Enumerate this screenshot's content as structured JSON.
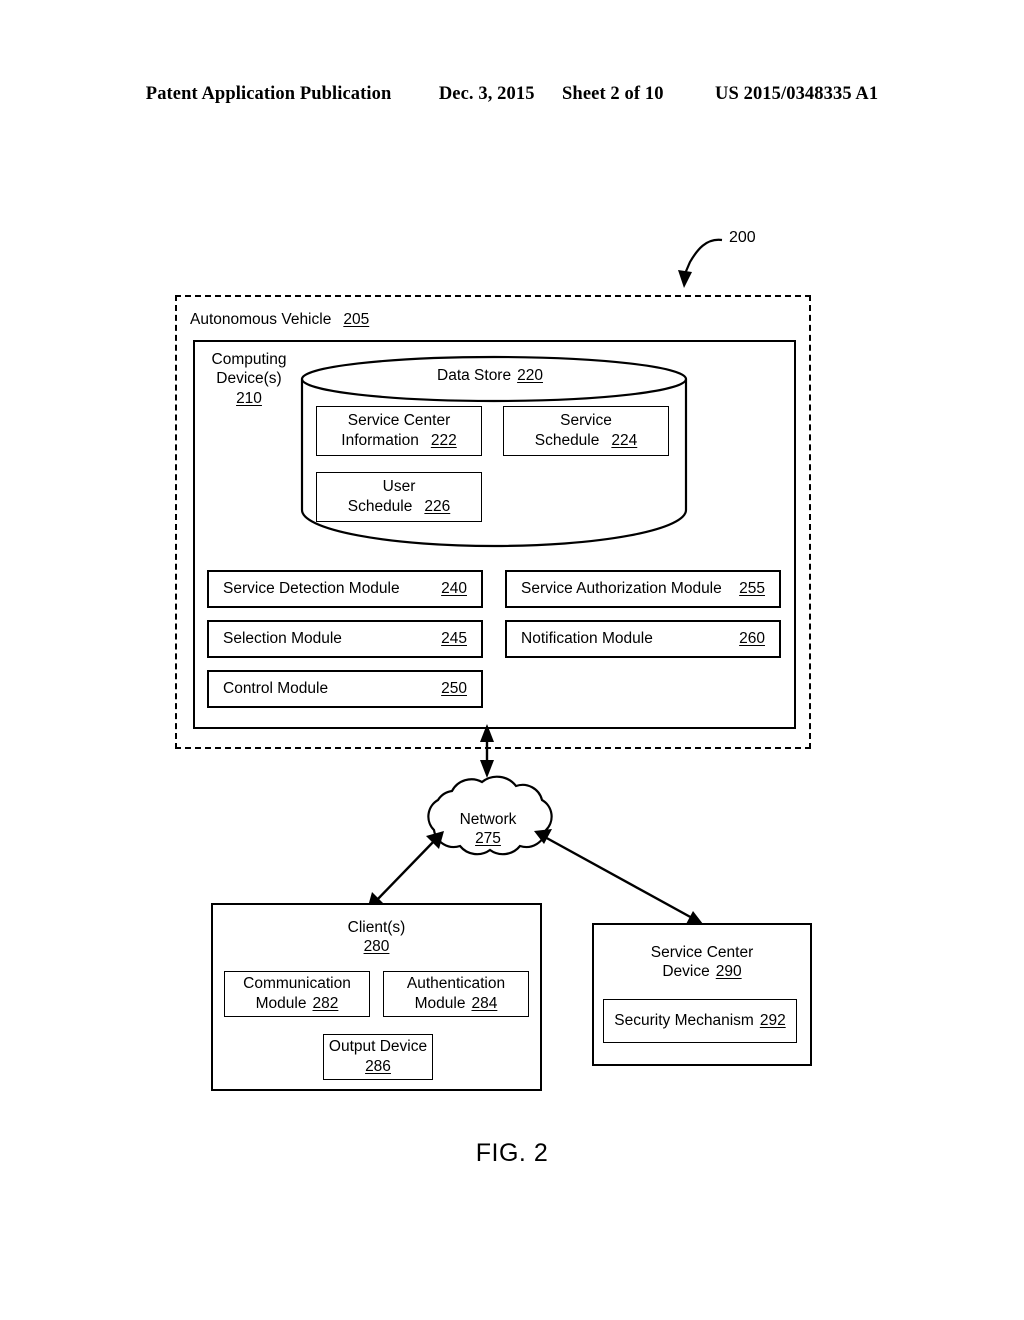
{
  "header": {
    "publication": "Patent Application Publication",
    "date": "Dec. 3, 2015",
    "sheet": "Sheet 2 of 10",
    "patent_number": "US 2015/0348335 A1"
  },
  "figure": {
    "caption": "FIG. 2",
    "system_ref": "200"
  },
  "vehicle": {
    "label": "Autonomous Vehicle",
    "ref": "205"
  },
  "computing_device": {
    "line1": "Computing",
    "line2": "Device(s)",
    "ref": "210"
  },
  "data_store": {
    "label": "Data Store",
    "ref": "220",
    "items": [
      {
        "line1": "Service Center",
        "line2": "Information",
        "ref": "222"
      },
      {
        "line1": "Service",
        "line2": "Schedule",
        "ref": "224"
      },
      {
        "line1": "User",
        "line2": "Schedule",
        "ref": "226"
      }
    ]
  },
  "modules": {
    "left": [
      {
        "label": "Service Detection Module",
        "ref": "240"
      },
      {
        "label": "Selection Module",
        "ref": "245"
      },
      {
        "label": "Control Module",
        "ref": "250"
      }
    ],
    "right": [
      {
        "label": "Service Authorization Module",
        "ref": "255"
      },
      {
        "label": "Notification Module",
        "ref": "260"
      }
    ]
  },
  "network": {
    "label": "Network",
    "ref": "275"
  },
  "client": {
    "label": "Client(s)",
    "ref": "280",
    "items": [
      {
        "line1": "Communication",
        "line2": "Module",
        "ref": "282"
      },
      {
        "line1": "Authentication",
        "line2": "Module",
        "ref": "284"
      },
      {
        "line1": "Output Device",
        "line2": "",
        "ref": "286"
      }
    ]
  },
  "service_center": {
    "line1": "Service Center",
    "line2": "Device",
    "ref": "290",
    "security": {
      "label": "Security Mechanism",
      "ref": "292"
    }
  },
  "colors": {
    "ink": "#000000",
    "paper": "#ffffff"
  }
}
